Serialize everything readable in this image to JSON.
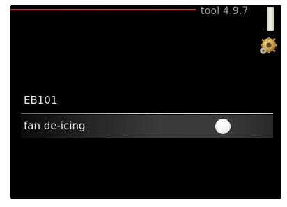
{
  "header": {
    "title": "tool 4.9.7"
  },
  "icons": {
    "status_indicator": "status-bar-icon",
    "settings": "gear-icon"
  },
  "section": {
    "label": "EB101"
  },
  "settings": [
    {
      "label": "fan de-icing",
      "state": "on"
    }
  ],
  "colors": {
    "background": "#000000",
    "accent_line": "#c7472a",
    "title_text": "#9c9c9c",
    "toggle_knob": "#ffffff"
  }
}
